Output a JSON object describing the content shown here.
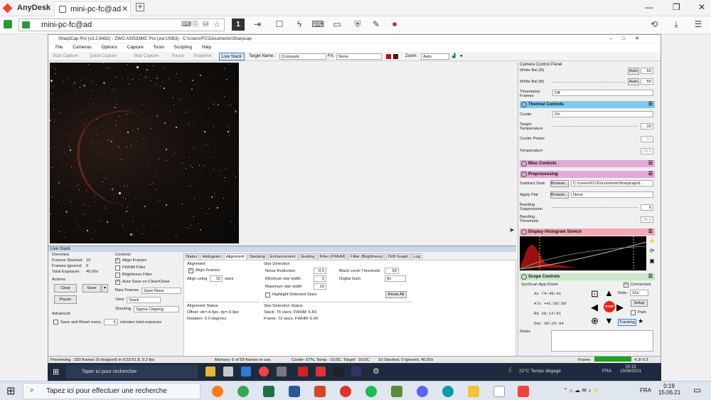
{
  "anydesk": {
    "app_name": "AnyDesk",
    "tab_label": "mini-pc-fc@ad",
    "address": "mini-pc-fc@ad",
    "display_number": "1"
  },
  "sharpcap": {
    "title": "SharpCap Pro (v3.2.6482) - ZWO ASI533MC Pro (via USB3) - C:\\Users\\FC\\Documents\\Sharpcap",
    "menu": [
      "File",
      "Cameras",
      "Options",
      "Capture",
      "Tools",
      "Scripting",
      "Help"
    ],
    "toolbar": {
      "start_capture": "Start Capture",
      "quick_capture": "Quick Capture",
      "stop_capture": "Stop Capture",
      "pause": "Pause",
      "snapshot": "Snapshot",
      "live_stack": "Live Stack",
      "target_label": "Target Name :",
      "target_value": "Croissant",
      "fx_label": "FX:",
      "fx_value": "None",
      "zoom_label": "Zoom:",
      "zoom_value": "Auto"
    },
    "camera_panel": {
      "title": "Camera Control Panel",
      "white_bal_r": "White Bal (R)",
      "white_bal_r_auto": "Auto",
      "white_bal_r_value": "50",
      "white_bal_b": "White Bal (B)",
      "white_bal_b_auto": "Auto",
      "white_bal_b_value": "50",
      "timestamp_label": "Timestamp Frames",
      "timestamp_value": "Off",
      "thermal_title": "Thermal Controls",
      "cooler_label": "Cooler",
      "cooler_value": "On",
      "target_temp_label": "Target Temperature",
      "target_temp_value": "-10",
      "cooler_power_label": "Cooler Power",
      "cooler_power_value": "57",
      "temperature_label": "Temperature",
      "temperature_value": "-10.0",
      "misc_title": "Misc Controls",
      "preproc_title": "Preprocessing",
      "subtract_dark_label": "Subtract Dark",
      "browse": "Browse...",
      "dark_path": "C:\\Users\\FC\\Documents\\Sharpcap\\d...",
      "apply_flat_label": "Apply Flat",
      "flat_value": "None",
      "banding_supp_label": "Banding Suppression",
      "banding_supp_value": "0",
      "banding_thr_label": "Banding Threshold",
      "banding_thr_value": "35.0",
      "histogram_title": "Display Histogram Stretch",
      "scope_title": "Scope Controls",
      "scope_driver": "SynScan App Driver",
      "connected": "Connected",
      "az": "Az  74:40:41",
      "alt": "Alt +41:56:59",
      "ra": "RA  20:12:51",
      "dec": "Dec  38:25:44",
      "rate_label": "Rate:",
      "rate_value": "16x",
      "setup": "Setup",
      "park": "Park",
      "tracking": "Tracking",
      "stop": "STOP",
      "notes_label": "Notes"
    },
    "live_stack": {
      "title": "Live Stack",
      "overview": "Overview",
      "frames_stacked_label": "Frames Stacked:",
      "frames_stacked": "10",
      "frames_ignored_label": "Frames Ignored:",
      "frames_ignored": "0",
      "total_exposure_label": "Total Exposure:",
      "total_exposure": "40.00s",
      "actions": "Actions",
      "clear": "Clear",
      "save": "Save",
      "pause": "Pause",
      "advanced": "Advanced",
      "save_reset_label": "Save and Reset every",
      "save_reset_value": "5",
      "save_reset_suffix": "minutes total exposure",
      "controls": "Controls",
      "align_frames": "Align Frames",
      "fwhm_filter": "FWHM Filter",
      "brightness_filter": "Brightness Filter",
      "auto_save": "Auto Save on Clear/Close",
      "raw_frames_label": "Raw Frames",
      "raw_frames_value": "Save None",
      "view_label": "View",
      "view_value": "Stack",
      "stacking_label": "Stacking",
      "stacking_value": "Sigma Clipping",
      "tabs": [
        "Status",
        "Histogram",
        "Alignment",
        "Stacking",
        "Enhancement",
        "Guiding",
        "Filter (FWHM)",
        "Filter (Brightness)",
        "Drift Graph",
        "Log"
      ],
      "alignment": "Alignment",
      "align_frames_chk": "Align Frames",
      "align_using": "Align using",
      "align_using_value": "15",
      "align_stars": "stars",
      "star_detection": "Star Detection",
      "noise_reduction": "Noise Reduction",
      "noise_reduction_value": "0.5",
      "min_star_width": "Minimum star width",
      "min_star_width_value": "2",
      "max_star_width": "Maximum star width",
      "max_star_width_value": "16",
      "highlight_stars": "Highlight Detected Stars",
      "black_level": "Black Level Threshold",
      "black_level_value": "50",
      "digital_gain": "Digital Gain",
      "digital_gain_value": "8x",
      "reset_all": "Reset All",
      "align_status_title": "Alignment Status",
      "align_offset": "Offset: dx=-4.5px, dy=-0.9px",
      "align_rotation": "Rotation: 0.0 degrees",
      "sd_status_title": "Star Detection Status",
      "sd_stack": "Stack:  76  stars, FWHM: 6.83",
      "sd_frame": "Frame:  72  stars, FWHM: 6.66"
    },
    "statusbar": {
      "previewing": "Previewing : 320 frames (0 dropped) in 0:23:51,8, 0.2 fps",
      "memory": "Memory: 5 of 59 frames in use.",
      "cooler": "Cooler: 67%, Temp: -10,0C, Target: -10,0C",
      "stacked": "10 Stacked, 0 Ignored, 40,00s",
      "frame_label": "Frame:",
      "frame_value": "4.3/-0.3"
    }
  },
  "remote_taskbar": {
    "search": "Taper ici pour rechercher",
    "weather": "22°C  Temps dégagé",
    "lang": "FRA",
    "time": "00:19",
    "date": "15/06/2021"
  },
  "local_taskbar": {
    "search": "Tapez ici pour effectuer une recherche",
    "lang": "FRA",
    "time": "0:19",
    "date": "15.06.21"
  }
}
